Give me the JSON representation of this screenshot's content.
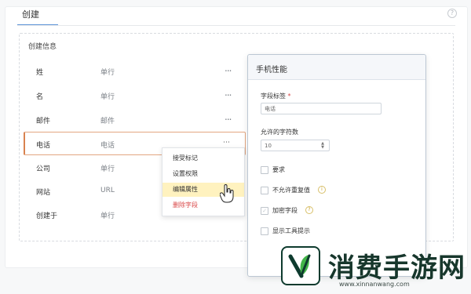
{
  "header": {
    "tab_label": "创建",
    "help_symbol": "?"
  },
  "section": {
    "title": "创建信息"
  },
  "fields": [
    {
      "label": "姓",
      "type": "单行",
      "more": "..."
    },
    {
      "label": "名",
      "type": "单行",
      "more": "..."
    },
    {
      "label": "邮件",
      "type": "邮件",
      "more": "..."
    },
    {
      "label": "电话",
      "type": "电话",
      "more": "⋯"
    },
    {
      "label": "公司",
      "type": "单行",
      "more": "..."
    },
    {
      "label": "网站",
      "type": "URL",
      "more": "..."
    },
    {
      "label": "创建于",
      "type": "单行",
      "more": "..."
    }
  ],
  "context_menu": {
    "items": [
      {
        "label": "接受标记"
      },
      {
        "label": "设置权限"
      },
      {
        "label": "编辑属性"
      },
      {
        "label": "删除字段"
      }
    ]
  },
  "panel": {
    "title": "手机性能",
    "field_label": "字段标签",
    "required_mark": "*",
    "field_value": "电话",
    "max_chars_label": "允许的字符数",
    "max_chars_value": "10",
    "spinner_up": "▲",
    "spinner_down": "▼",
    "options": [
      {
        "label": "要求"
      },
      {
        "label": "不允许重复值"
      },
      {
        "label": "加密字段"
      },
      {
        "label": "显示工具提示"
      }
    ]
  },
  "watermark": {
    "name": "消费手游网",
    "url": "www.xinnanwang.com"
  },
  "colors": {
    "accent_blue": "#5f96d8",
    "active_row_orange": "#d9824f",
    "menu_hover": "#fff2bf",
    "danger_red": "#d94747",
    "watermark_green": "#17372c"
  },
  "icons": {
    "help": "help-icon",
    "more": "more-icon",
    "pointer": "hand-pointer-icon",
    "info": "info-icon",
    "checkbox": "checkbox-icon"
  }
}
